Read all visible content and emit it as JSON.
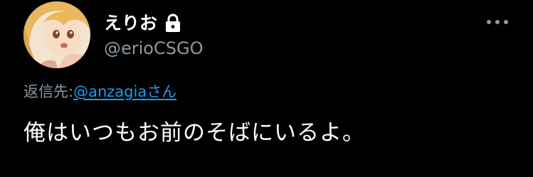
{
  "author": {
    "display_name": "えりお",
    "handle": "@erioCSGO"
  },
  "reply": {
    "prefix": "返信先: ",
    "mention": "@anzagia",
    "suffix": "さん"
  },
  "tweet": {
    "text": "俺はいつもお前のそばにいるよ。"
  },
  "icons": {
    "lock": "lock-icon",
    "more": "more-dots-icon"
  },
  "colors": {
    "background": "#000000",
    "primary_text": "#ffffff",
    "secondary_text": "#8b98a5",
    "link": "#1d9bf0"
  }
}
